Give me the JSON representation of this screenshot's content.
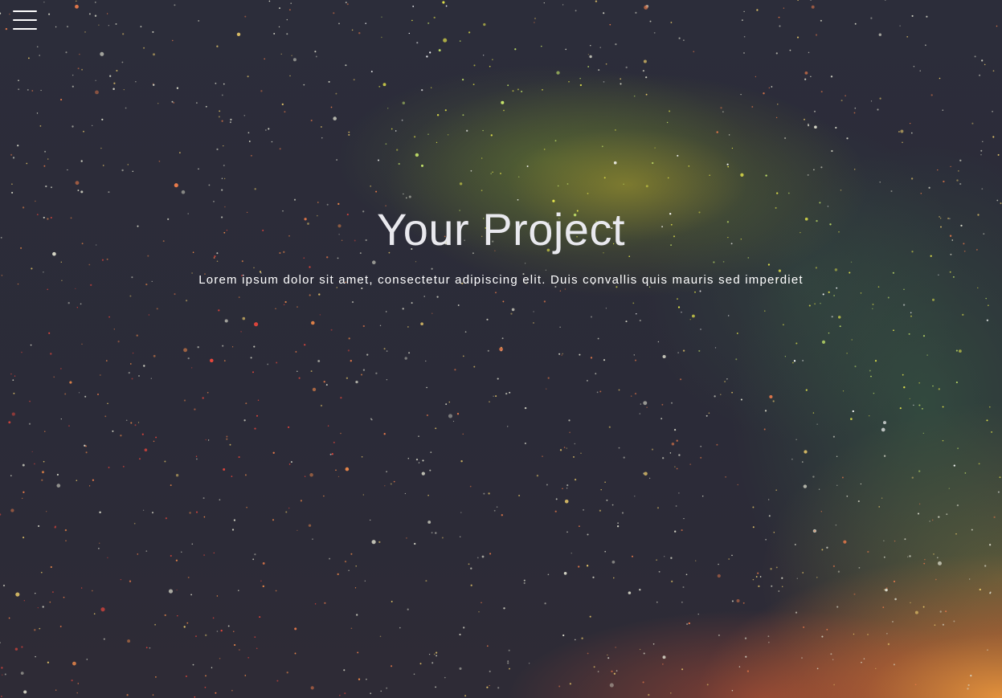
{
  "hero": {
    "title": "Your Project",
    "subtitle": "Lorem ipsum dolor sit amet, consectetur adipiscing elit. Duis convallis quis mauris sed imperdiet",
    "background": "starry-night-sky"
  },
  "nav": {
    "menu_icon": "hamburger-menu-icon"
  },
  "colors": {
    "background": "#2b2b38",
    "text": "#ffffff",
    "title": "#e9e9ee",
    "glow_orange": "#e8963c",
    "glow_green": "#5a8a4a"
  }
}
